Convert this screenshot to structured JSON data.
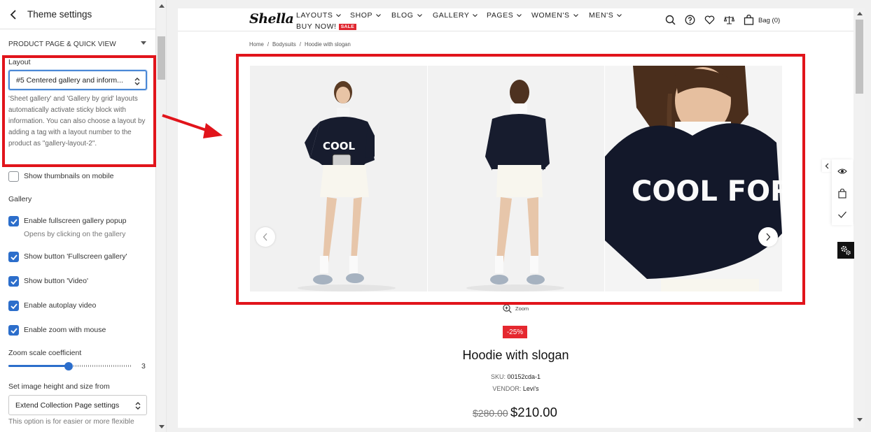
{
  "panel": {
    "title": "Theme settings",
    "section": "PRODUCT PAGE & QUICK VIEW",
    "layout_label": "Layout",
    "layout_value": "#5 Centered gallery and inform...",
    "layout_help": "'Sheet gallery' and 'Gallery by grid' layouts automatically activate sticky block with information. You can also choose a layout by adding a tag with a layout number to the product as \"gallery-layout-2\".",
    "show_thumbs": "Show thumbnails on mobile",
    "gallery_label": "Gallery",
    "fullscreen_popup": "Enable fullscreen gallery popup",
    "fullscreen_popup_sub": "Opens by clicking on the gallery",
    "btn_fullscreen": "Show button 'Fullscreen gallery'",
    "btn_video": "Show button 'Video'",
    "autoplay": "Enable autoplay video",
    "zoom_mouse": "Enable zoom with mouse",
    "zoom_scale_label": "Zoom scale coefficient",
    "zoom_scale_value": "3",
    "zoom_scale_fraction": 0.49,
    "image_height_label": "Set image height and size from",
    "image_height_value": "Extend Collection Page settings",
    "image_height_help": "This option is for easier or more flexible"
  },
  "store": {
    "logo": "Shella",
    "nav": [
      {
        "label": "LAYOUTS"
      },
      {
        "label": "SHOP"
      },
      {
        "label": "BLOG"
      },
      {
        "label": "GALLERY"
      },
      {
        "label": "PAGES"
      },
      {
        "label": "WOMEN'S"
      },
      {
        "label": "MEN'S"
      }
    ],
    "buy_now": "BUY NOW!",
    "sale_badge": "SALE",
    "bag": "Bag (0)",
    "breadcrumb": [
      "Home",
      "/",
      "Bodysuits",
      "/",
      "Hoodie with slogan"
    ],
    "zoom": "Zoom",
    "discount": "-25%",
    "product_title": "Hoodie with slogan",
    "sku_label": "SKU:",
    "sku": "00152cda-1",
    "vendor_label": "VENDOR:",
    "vendor": "Levi's",
    "price_old": "$280.00",
    "price_new": "$210.00",
    "sweater_text": "COOL FOR"
  },
  "colors": {
    "annotation_red": "#e1141b",
    "checkbox_blue": "#2c6ecb",
    "sale_red": "#e0262f"
  }
}
